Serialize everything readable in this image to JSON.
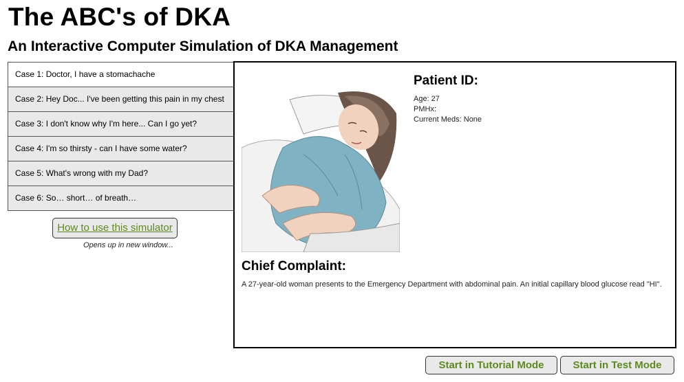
{
  "header": {
    "title": "The ABC's of DKA",
    "subtitle": "An Interactive Computer Simulation of DKA Management"
  },
  "cases": [
    {
      "label": "Case 1: Doctor, I have a stomachache"
    },
    {
      "label": "Case 2: Hey Doc... I've been getting this pain in my chest"
    },
    {
      "label": "Case 3: I don't know why I'm here... Can I go yet?"
    },
    {
      "label": "Case 4: I'm so thirsty - can I have some water?"
    },
    {
      "label": "Case 5: What's wrong with my Dad?"
    },
    {
      "label": "Case 6: So… short… of breath…"
    }
  ],
  "help": {
    "button_label": "How to use this simulator",
    "note": "Opens up in new window..."
  },
  "patient": {
    "id_title": "Patient ID:",
    "age": "Age: 27",
    "pmhx": "PMHx:",
    "meds": "Current Meds: None"
  },
  "complaint": {
    "title": "Chief Complaint:",
    "text": "A 27-year-old woman presents to the Emergency Department with abdominal pain. An initial capillary blood glucose read \"HI\"."
  },
  "actions": {
    "tutorial_label": "Start in Tutorial Mode",
    "test_label": "Start in Test Mode"
  },
  "colors": {
    "accent_green": "#5c8a1e",
    "button_bg": "#e9e9e9"
  }
}
